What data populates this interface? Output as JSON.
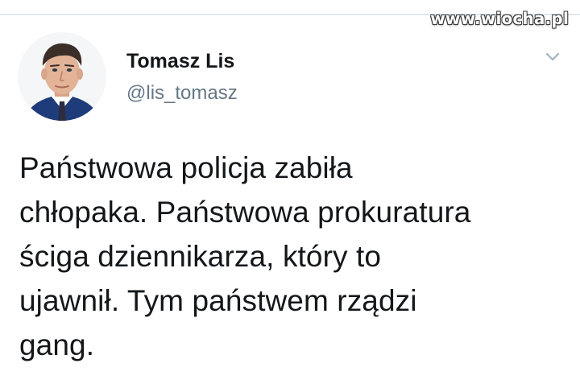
{
  "watermark": "www.wiocha.pl",
  "author": {
    "display_name": "Tomasz Lis",
    "handle": "@lis_tomasz"
  },
  "tweet": {
    "lines": [
      "Państwowa policja zabiła",
      "chłopaka. Państwowa prokuratura",
      "ściga dziennikarza, który to",
      "ujawnił. Tym państwem rządzi",
      "gang."
    ]
  },
  "icons": {
    "menu": "chevron-down-icon",
    "avatar": "profile-photo"
  },
  "colors": {
    "text_primary": "#14171a",
    "text_secondary": "#657786",
    "divider": "#e1e8ed"
  }
}
